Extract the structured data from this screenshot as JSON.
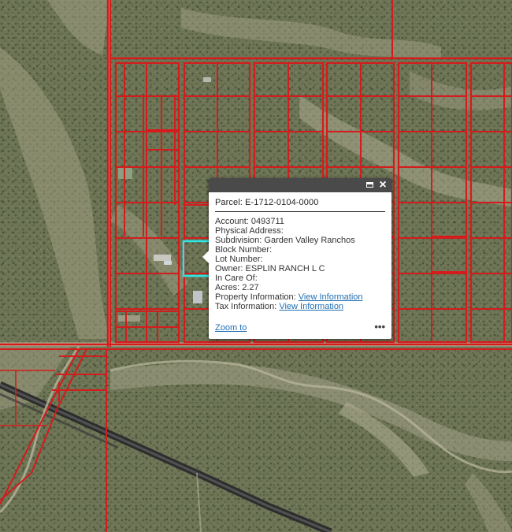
{
  "map": {
    "basemap": "satellite-imagery",
    "parcel_line_color": "#d41c1c",
    "selected_parcel_color": "#2ee6e6",
    "road_color": "#2d2d2d"
  },
  "popup": {
    "title": "Parcel: E-1712-0104-0000",
    "fields": [
      {
        "label": "Account:",
        "value": "0493711"
      },
      {
        "label": "Physical Address:",
        "value": ""
      },
      {
        "label": "Subdivision:",
        "value": "Garden Valley Ranchos"
      },
      {
        "label": "Block Number:",
        "value": ""
      },
      {
        "label": "Lot Number:",
        "value": ""
      },
      {
        "label": "Owner:",
        "value": "ESPLIN RANCH L C"
      },
      {
        "label": "In Care Of:",
        "value": ""
      },
      {
        "label": "Acres:",
        "value": "2.27"
      }
    ],
    "links": [
      {
        "label": "Property Information:",
        "link_text": "View Information"
      },
      {
        "label": "Tax Information:",
        "link_text": "View Information"
      }
    ],
    "footer": {
      "zoom_label": "Zoom to",
      "more_label": "•••"
    },
    "close_icon": "close-icon",
    "maximize_icon": "maximize-icon",
    "header_color": "#4a4a4a",
    "link_color": "#1f6fb2"
  }
}
